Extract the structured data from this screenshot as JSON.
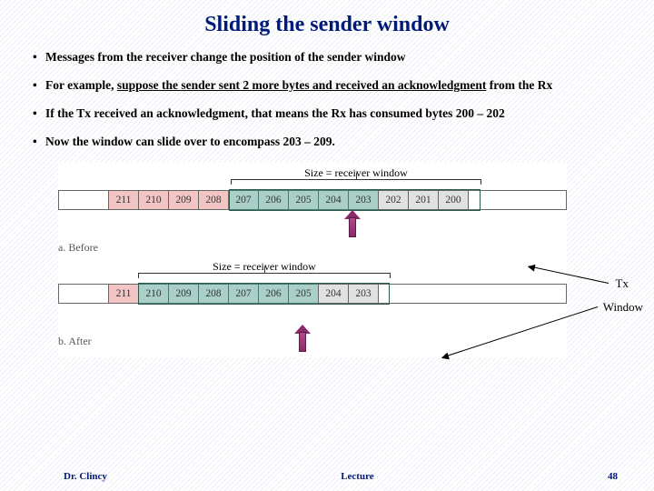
{
  "title": "Sliding the sender window",
  "bullets": [
    "Messages from the receiver change the position of the sender window",
    "For example, <span class=\"underline\">suppose the sender sent 2 more bytes and received an acknowledgment</span> from the Rx",
    "If the Tx received an acknowledgment, that means the Rx has consumed bytes 200 – 202",
    "Now the window can slide over to encompass 203 – 209."
  ],
  "figure": {
    "size_label_before": "Size = receiver window",
    "size_label_after": "Size = receiver window",
    "before_cells": [
      "211",
      "210",
      "209",
      "208",
      "207",
      "206",
      "205",
      "204",
      "203",
      "202",
      "201",
      "200"
    ],
    "before_window_teal": [
      4,
      5,
      6,
      7,
      8
    ],
    "before_gray": [
      9,
      10,
      11
    ],
    "after_cells": [
      "211",
      "210",
      "209",
      "208",
      "207",
      "206",
      "205",
      "204",
      "203"
    ],
    "after_window_teal": [
      1,
      2,
      3,
      4,
      5,
      6
    ],
    "after_gray": [
      7,
      8
    ],
    "caption_before": "a. Before",
    "caption_after": "b. After"
  },
  "side_labels": {
    "tx": "Tx",
    "window": "Window"
  },
  "footer": {
    "left": "Dr. Clincy",
    "mid": "Lecture",
    "right": "48"
  }
}
